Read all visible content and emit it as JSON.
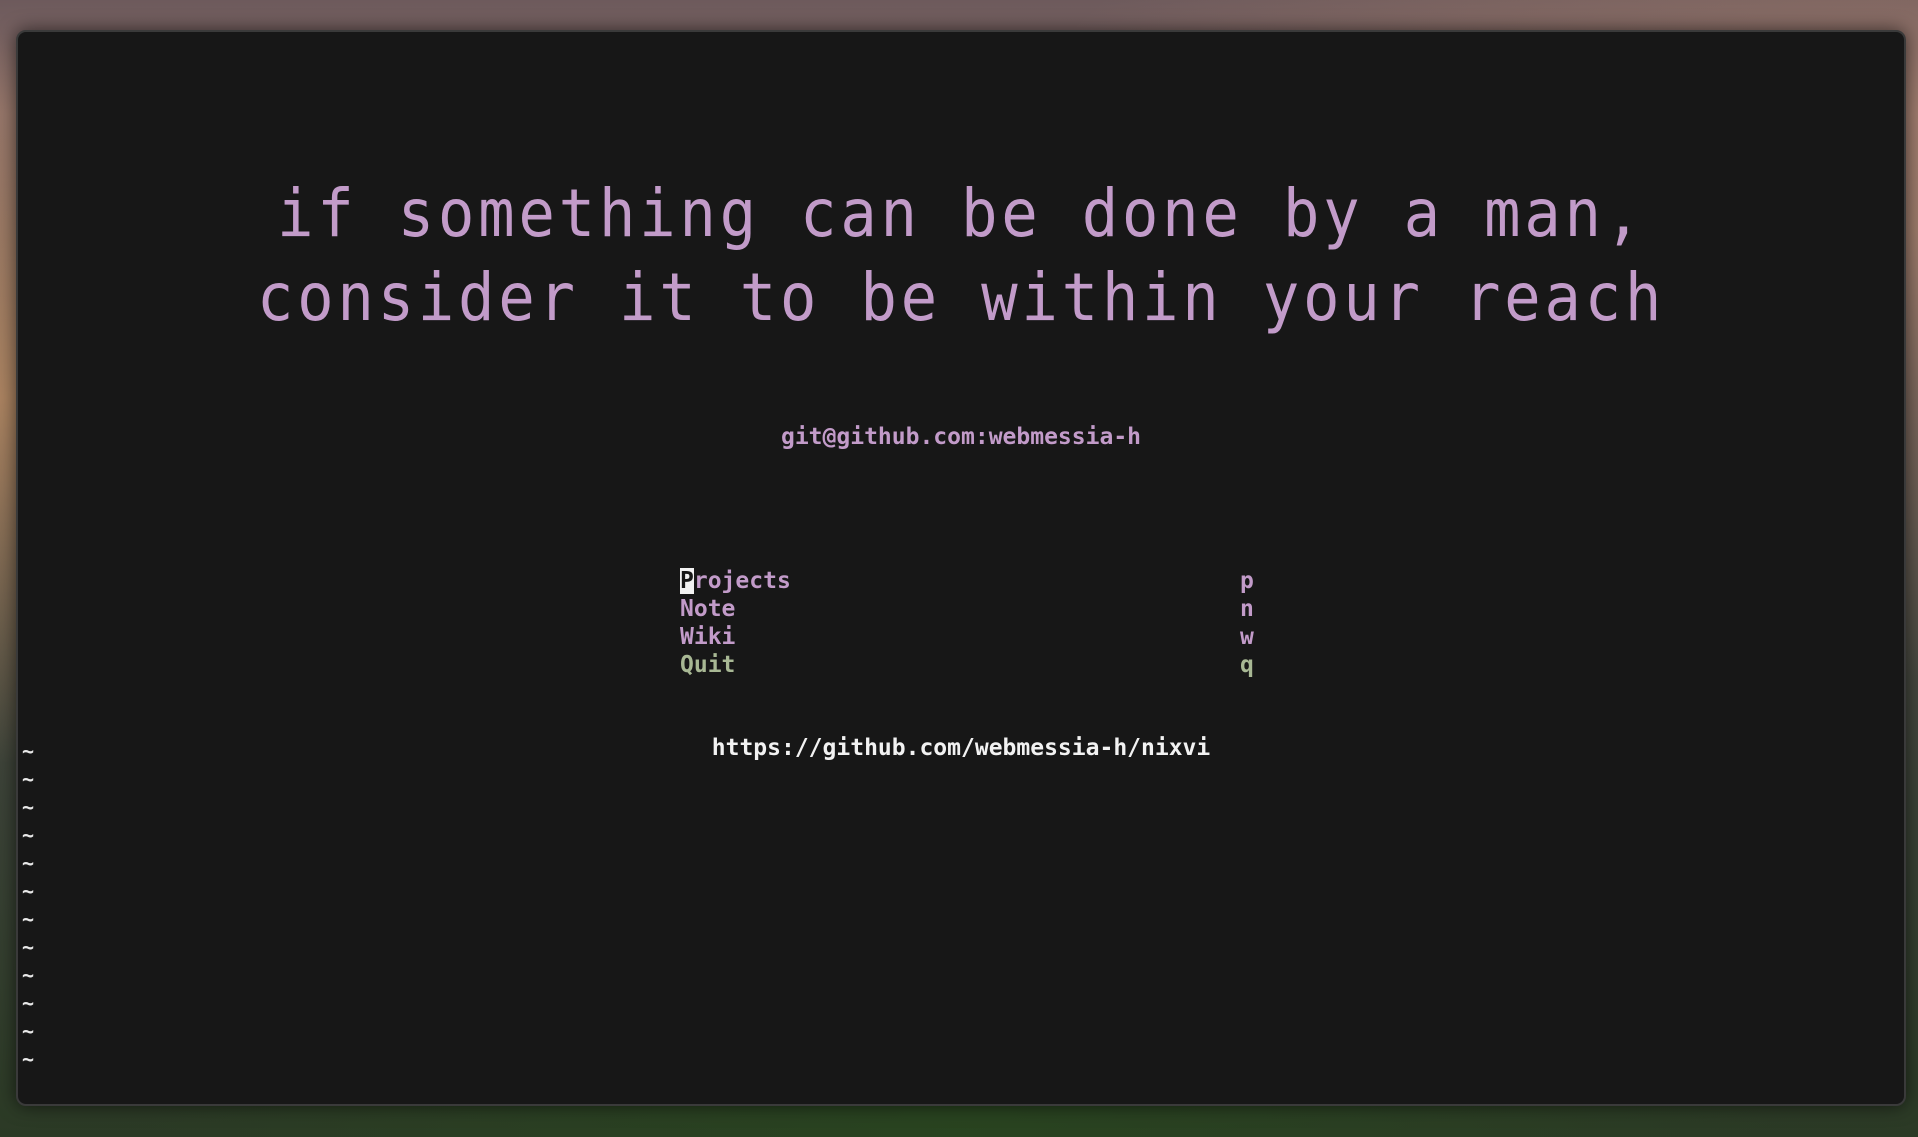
{
  "quote": {
    "line1": "if something can be done by a man,",
    "line2": "consider it to be within your reach"
  },
  "handle": "git@github.com:webmessia-h",
  "menu": {
    "items": [
      {
        "first_char": "P",
        "rest": "rojects",
        "key": "p"
      },
      {
        "label": "Note",
        "key": "n"
      },
      {
        "label": "Wiki",
        "key": "w"
      },
      {
        "label": "Quit",
        "key": "q"
      }
    ]
  },
  "url": "https://github.com/webmessia-h/nixvi",
  "empty_line_marker": "~",
  "colors": {
    "accent": "#c29bc9",
    "quit": "#a8b894",
    "background": "#171717",
    "text": "#f2f2f2"
  }
}
